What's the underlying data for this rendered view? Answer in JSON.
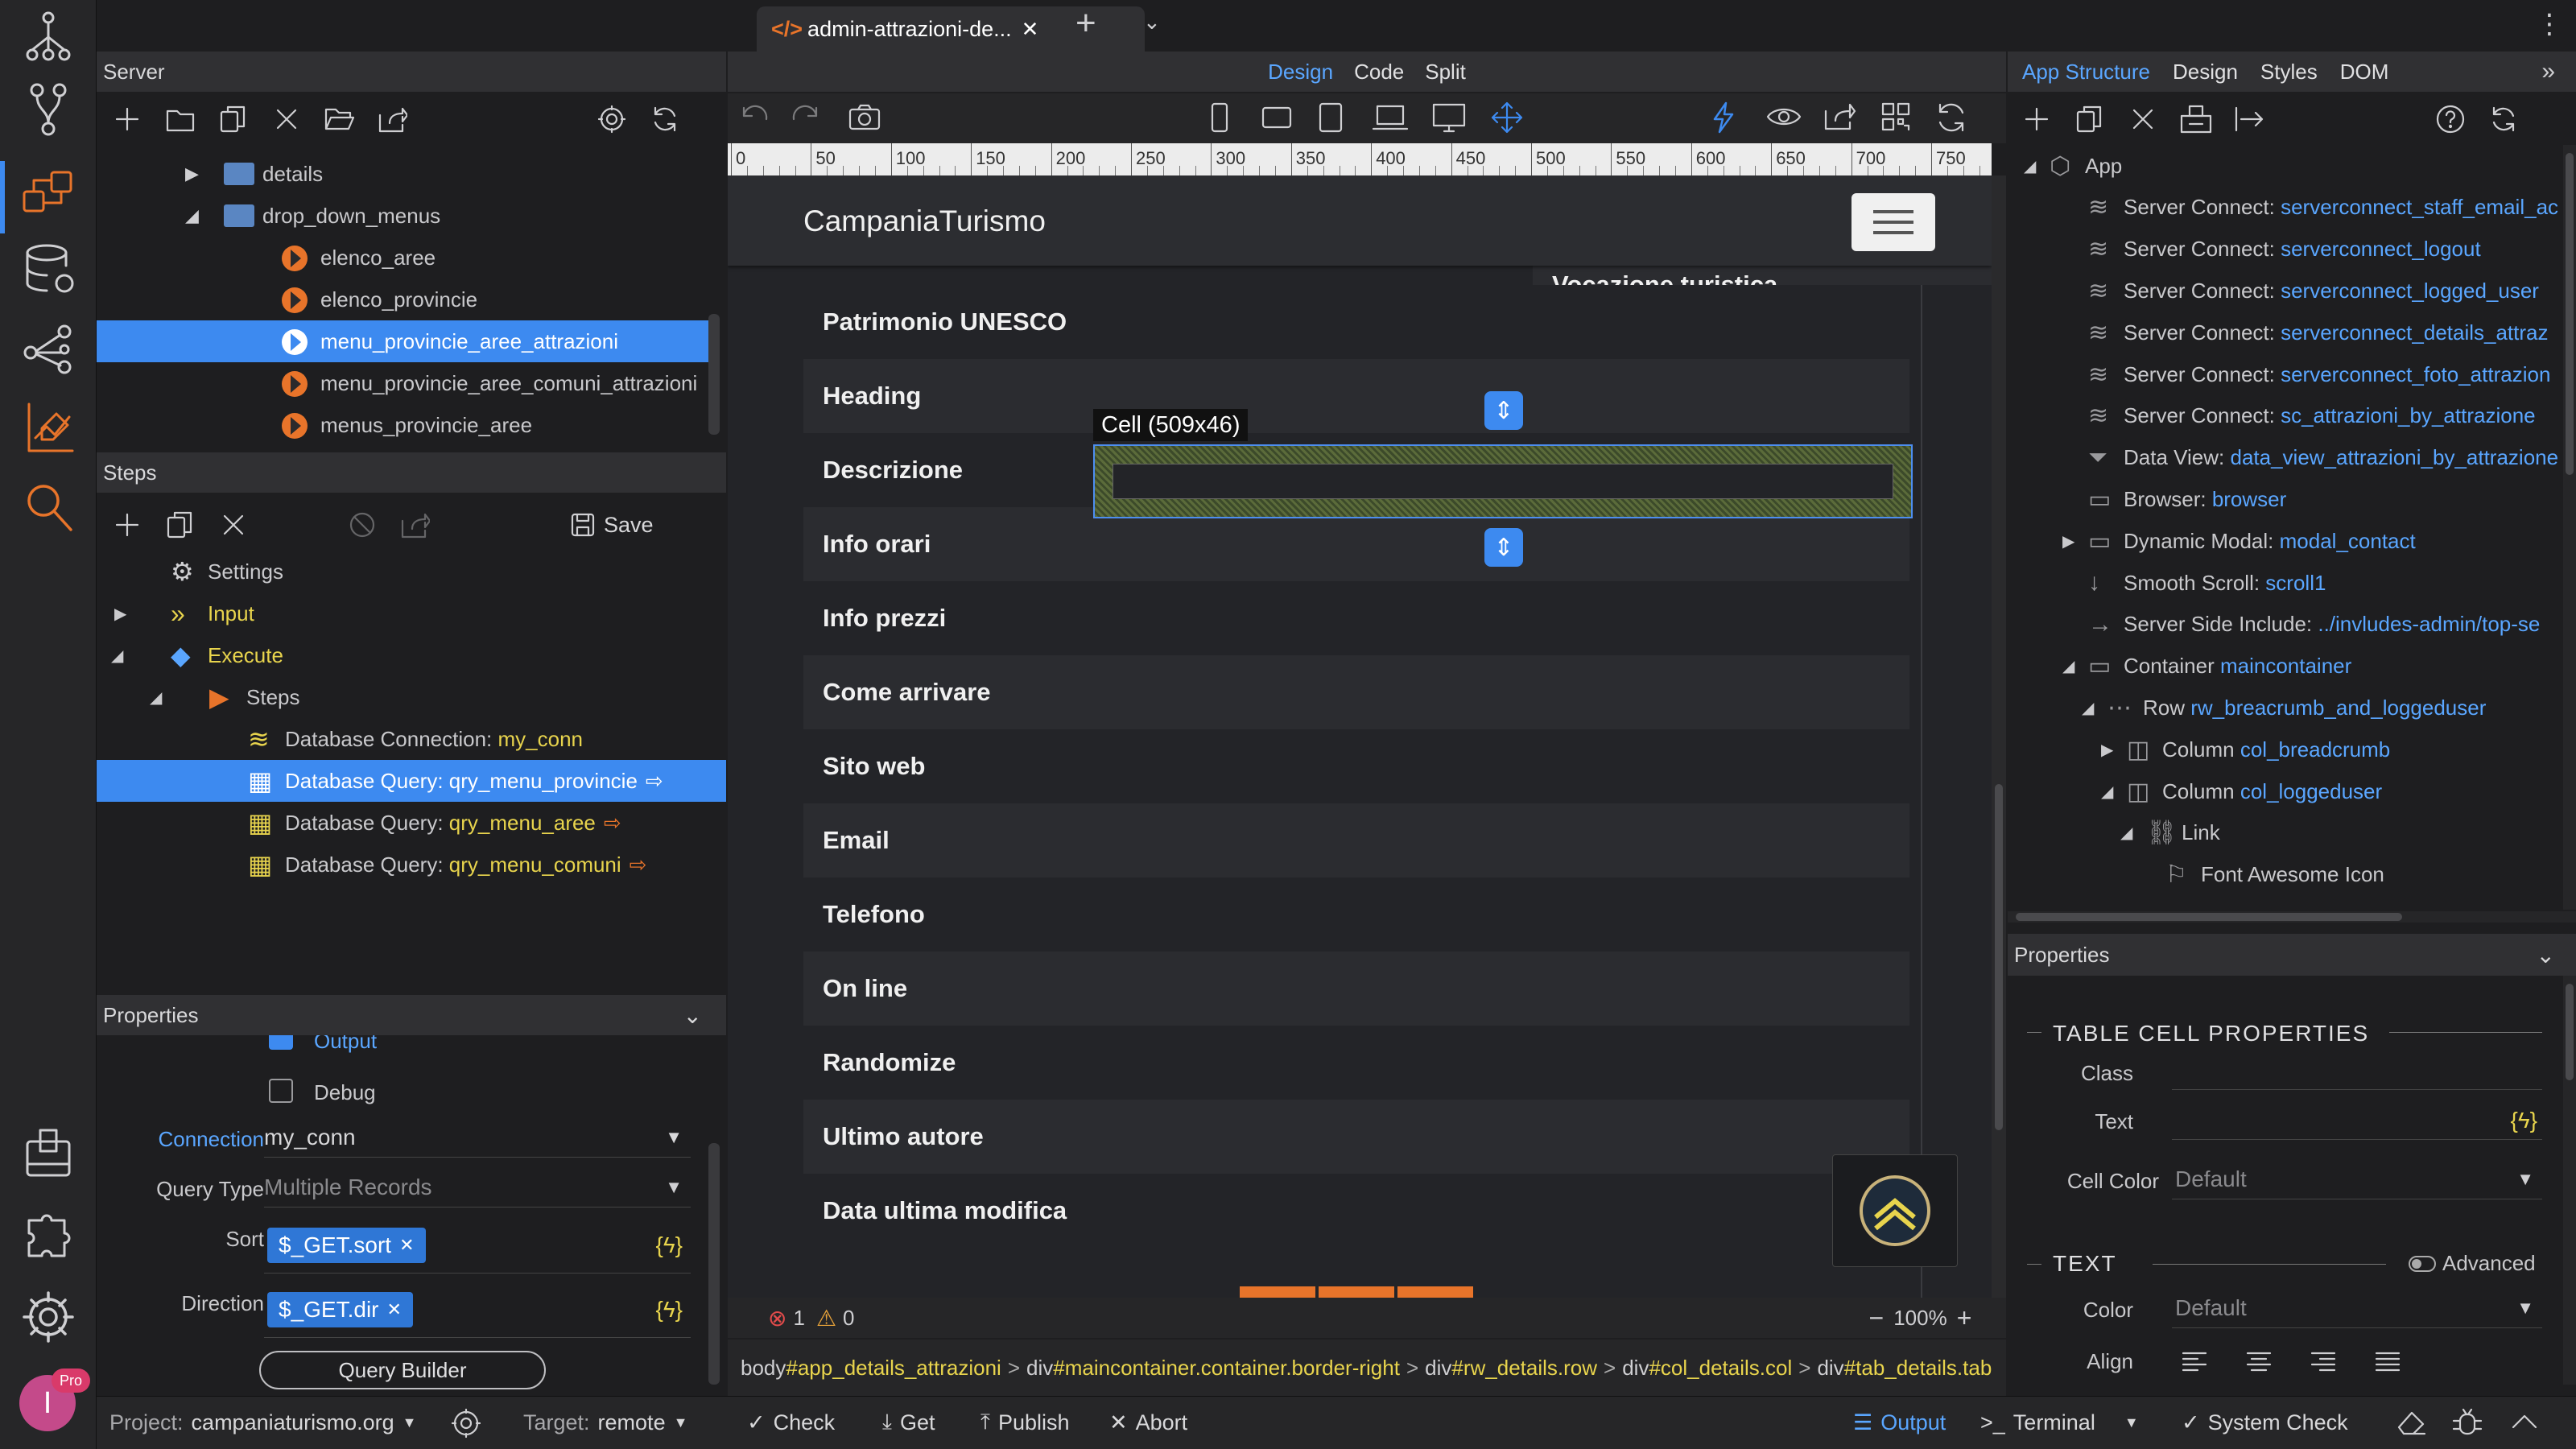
{
  "tab": {
    "title": "admin-attrazioni-de..."
  },
  "view_modes": [
    "Design",
    "Code",
    "Split"
  ],
  "right_tabs": [
    "App Structure",
    "Design",
    "Styles",
    "DOM"
  ],
  "server": {
    "title": "Server",
    "tree": [
      {
        "label": "details",
        "type": "folder",
        "indent": 1,
        "expanded": false
      },
      {
        "label": "drop_down_menus",
        "type": "folder",
        "indent": 1,
        "expanded": true
      },
      {
        "label": "elenco_aree",
        "type": "action",
        "indent": 2
      },
      {
        "label": "elenco_provincie",
        "type": "action",
        "indent": 2
      },
      {
        "label": "menu_provincie_aree_attrazioni",
        "type": "action",
        "indent": 2,
        "selected": true
      },
      {
        "label": "menu_provincie_aree_comuni_attrazioni",
        "type": "action",
        "indent": 2
      },
      {
        "label": "menus_provincie_aree",
        "type": "action",
        "indent": 2
      }
    ]
  },
  "steps": {
    "title": "Steps",
    "save_label": "Save",
    "tree": [
      {
        "label": "Settings",
        "indent": 1
      },
      {
        "label": "Input",
        "indent": 1,
        "color": "yellow"
      },
      {
        "label": "Execute",
        "indent": 1,
        "color": "yellow"
      },
      {
        "label": "Steps",
        "indent": 2
      },
      {
        "prefix": "Database Connection: ",
        "name": "my_conn",
        "indent": 3
      },
      {
        "prefix": "Database Query: ",
        "name": "qry_menu_provincie",
        "indent": 3,
        "selected": true
      },
      {
        "prefix": "Database Query: ",
        "name": "qry_menu_aree",
        "indent": 3
      },
      {
        "prefix": "Database Query: ",
        "name": "qry_menu_comuni",
        "indent": 3
      }
    ]
  },
  "left_props": {
    "title": "Properties",
    "output_label": "Output",
    "debug_label": "Debug",
    "connection_label": "Connection",
    "connection_value": "my_conn",
    "querytype_label": "Query Type",
    "querytype_value": "Multiple Records",
    "sort_label": "Sort",
    "sort_value": "$_GET.sort",
    "direction_label": "Direction",
    "direction_value": "$_GET.dir",
    "query_builder": "Query Builder"
  },
  "ruler": [
    "0",
    "50",
    "100",
    "150",
    "200",
    "250",
    "300",
    "350",
    "400",
    "450",
    "500",
    "550",
    "600",
    "650",
    "700",
    "750"
  ],
  "canvas": {
    "brand": "CampaniaTurismo",
    "rows": [
      "Patrimonio UNESCO",
      "Heading",
      "Descrizione",
      "Info orari",
      "Info prezzi",
      "Come arrivare",
      "Sito web",
      "Email",
      "Telefono",
      "On line",
      "Randomize",
      "Ultimo autore",
      "Data ultima modifica"
    ],
    "top_partial": "Vocazione turistica",
    "cell_tooltip": "Cell (509x46)"
  },
  "status": {
    "errors": "1",
    "warnings": "0",
    "zoom": "100%"
  },
  "breadcrumb": [
    {
      "tag": "body",
      "id": "#app_details_attrazioni"
    },
    {
      "tag": "div",
      "id": "#maincontainer.container.border-right"
    },
    {
      "tag": "div",
      "id": "#rw_details.row"
    },
    {
      "tag": "div",
      "id": "#col_details.col"
    },
    {
      "tag": "div",
      "id": "#tab_details.tab"
    }
  ],
  "structure": {
    "items": [
      {
        "label": "App",
        "indent": 0,
        "expand": "open"
      },
      {
        "prefix": "Server Connect: ",
        "name": "serverconnect_staff_email_ac",
        "indent": 2
      },
      {
        "prefix": "Server Connect: ",
        "name": "serverconnect_logout",
        "indent": 2
      },
      {
        "prefix": "Server Connect: ",
        "name": "serverconnect_logged_user",
        "indent": 2
      },
      {
        "prefix": "Server Connect: ",
        "name": "serverconnect_details_attraz",
        "indent": 2
      },
      {
        "prefix": "Server Connect: ",
        "name": "serverconnect_foto_attrazion",
        "indent": 2
      },
      {
        "prefix": "Server Connect: ",
        "name": "sc_attrazioni_by_attrazione",
        "indent": 2
      },
      {
        "prefix": "Data View: ",
        "name": "data_view_attrazioni_by_attrazione",
        "indent": 2
      },
      {
        "prefix": "Browser: ",
        "name": "browser",
        "indent": 2
      },
      {
        "prefix": "Dynamic Modal: ",
        "name": "modal_contact",
        "indent": 2,
        "expand": "closed"
      },
      {
        "prefix": "Smooth Scroll: ",
        "name": "scroll1",
        "indent": 2
      },
      {
        "prefix": "Server Side Include: ",
        "name": "../invludes-admin/top-se",
        "indent": 2
      },
      {
        "prefix": "Container ",
        "name": "maincontainer",
        "indent": 2,
        "expand": "open"
      },
      {
        "prefix": "Row ",
        "name": "rw_breacrumb_and_loggeduser",
        "indent": 3,
        "expand": "open"
      },
      {
        "prefix": "Column ",
        "name": "col_breadcrumb",
        "indent": 4,
        "expand": "closed"
      },
      {
        "prefix": "Column ",
        "name": "col_loggeduser",
        "indent": 4,
        "expand": "open"
      },
      {
        "label": "Link",
        "indent": 5,
        "expand": "open"
      },
      {
        "label": "Font Awesome Icon",
        "indent": 6
      }
    ]
  },
  "right_props": {
    "title": "Properties",
    "section": "TABLE CELL PROPERTIES",
    "class_label": "Class",
    "text_label": "Text",
    "cellcolor_label": "Cell Color",
    "cellcolor_value": "Default",
    "text_section": "TEXT",
    "advanced_label": "Advanced",
    "color_label": "Color",
    "color_value": "Default",
    "align_label": "Align"
  },
  "bottom": {
    "project_label": "Project:",
    "project_value": "campaniaturismo.org",
    "target_label": "Target:",
    "target_value": "remote",
    "check": "Check",
    "get": "Get",
    "publish": "Publish",
    "abort": "Abort",
    "output": "Output",
    "terminal": "Terminal",
    "system_check": "System Check"
  },
  "colors": {
    "accent": "#3d8af0",
    "link": "#5aa6ff",
    "yellow": "#e8d44d",
    "orange": "#e8742a"
  }
}
